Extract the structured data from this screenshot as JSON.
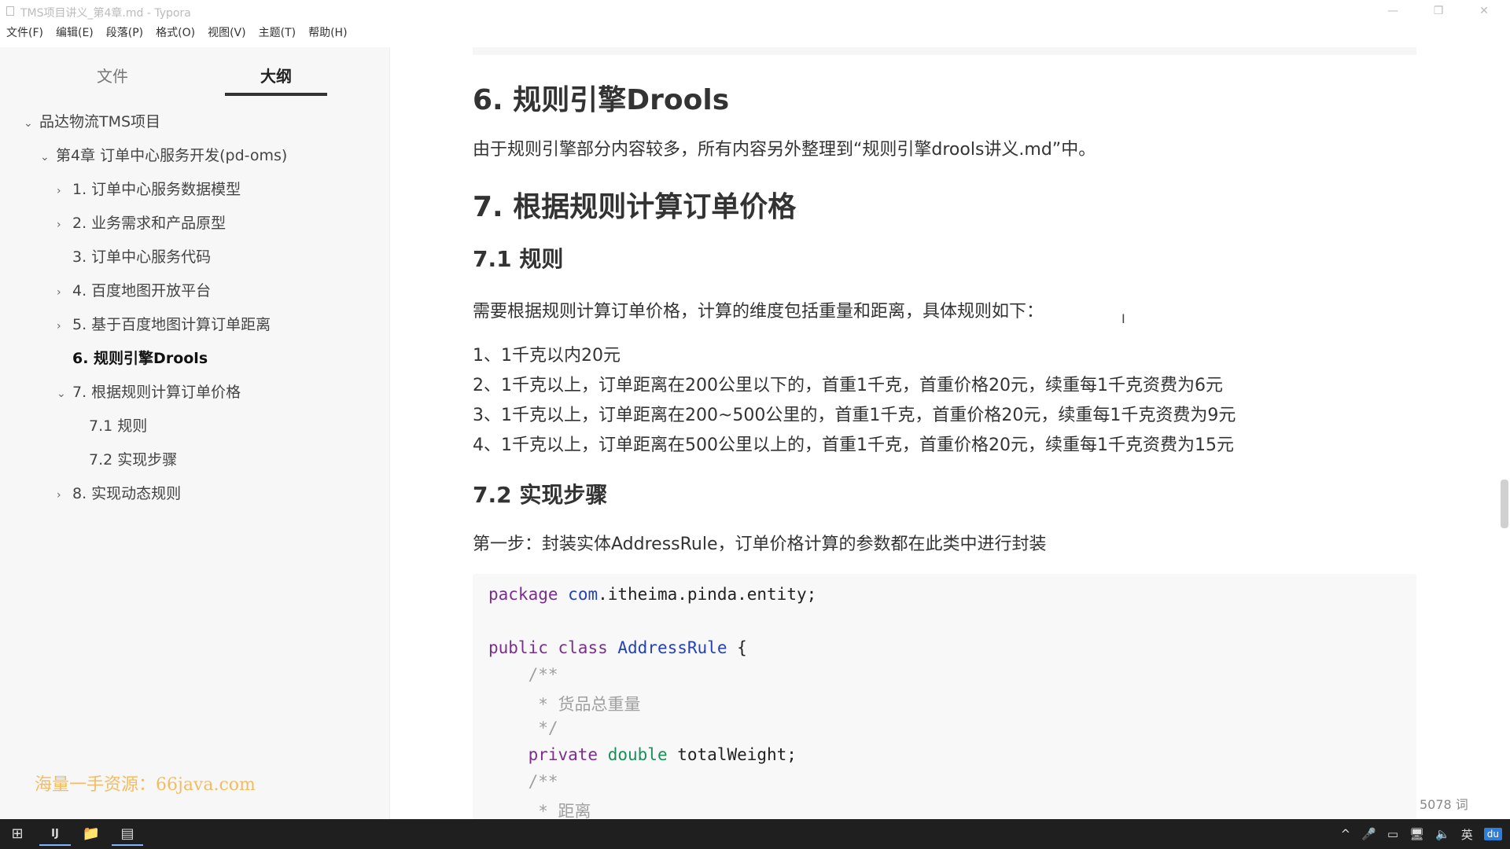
{
  "window": {
    "title": "TMS项目讲义_第4章.md - Typora",
    "controls": {
      "minimize": "—",
      "maximize": "❐",
      "close": "✕"
    }
  },
  "menu": [
    "文件(F)",
    "编辑(E)",
    "段落(P)",
    "格式(O)",
    "视图(V)",
    "主题(T)",
    "帮助(H)"
  ],
  "sidebar": {
    "tabs": [
      "文件",
      "大纲"
    ],
    "active_tab": "大纲",
    "outline": [
      {
        "label": "品达物流TMS项目",
        "chevron": "⌄"
      },
      {
        "label": "第4章 订单中心服务开发(pd-oms)",
        "chevron": "⌄"
      },
      {
        "label": "1. 订单中心服务数据模型",
        "chevron": "›"
      },
      {
        "label": "2. 业务需求和产品原型",
        "chevron": "›"
      },
      {
        "label": "3. 订单中心服务代码",
        "chevron": ""
      },
      {
        "label": "4. 百度地图开放平台",
        "chevron": "›"
      },
      {
        "label": "5. 基于百度地图计算订单距离",
        "chevron": "›"
      },
      {
        "label": "6. 规则引擎Drools",
        "chevron": ""
      },
      {
        "label": "7. 根据规则计算订单价格",
        "chevron": "⌄"
      },
      {
        "label": "7.1 规则",
        "chevron": ""
      },
      {
        "label": "7.2 实现步骤",
        "chevron": ""
      },
      {
        "label": "8. 实现动态规则",
        "chevron": "›"
      }
    ],
    "active_item": "6. 规则引擎Drools",
    "watermark": "海量一手资源：66java.com",
    "bottom": {
      "back": "‹",
      "source": "</>"
    }
  },
  "content": {
    "h_drools": "6. 规则引擎Drools",
    "p_drools": "由于规则引擎部分内容较多，所有内容另外整理到“规则引擎drools讲义.md”中。",
    "h_price": "7. 根据规则计算订单价格",
    "h_rule": "7.1 规则",
    "p_rule": "需要根据规则计算订单价格，计算的维度包括重量和距离，具体规则如下：",
    "rules": [
      "1、1千克以内20元",
      "2、1千克以上，订单距离在200公里以下的，首重1千克，首重价格20元，续重每1千克资费为6元",
      "3、1千克以上，订单距离在200~500公里的，首重1千克，首重价格20元，续重每1千克资费为9元",
      "4、1千克以上，订单距离在500公里以上的，首重1千克，首重价格20元，续重每1千克资费为15元"
    ],
    "h_steps": "7.2 实现步骤",
    "p_step1": "第一步：封装实体AddressRule，订单价格计算的参数都在此类中进行封装",
    "code": {
      "pkg_kw": "package",
      "pkg_root": "com",
      "pkg_rest": ".itheima.pinda.entity;",
      "public_kw": "public",
      "class_kw": "class",
      "class_name": "AddressRule",
      "brace": " {",
      "c1_open": "    /**",
      "c1_body": "     * 货品总重量",
      "c1_close": "     */",
      "private_kw": "    private",
      "double_kw": "double",
      "field1": " totalWeight;",
      "c2_open": "    /**",
      "c2_body": "     * 距离"
    }
  },
  "status": {
    "word_count": "5078 词",
    "cursor": "I"
  },
  "taskbar": {
    "start": "⊞",
    "apps": [
      "IJ",
      "📁",
      "▤"
    ],
    "tray": [
      "^",
      "🎤",
      "▭",
      "🖥",
      "🔈",
      "英"
    ],
    "ime": "du"
  }
}
